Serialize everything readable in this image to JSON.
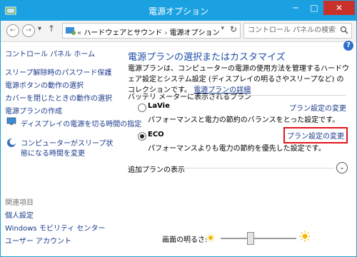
{
  "window": {
    "title": "電源オプション",
    "controls": {
      "minimize": "─",
      "maximize": "□",
      "close": "✕"
    }
  },
  "nav": {
    "back": "←",
    "forward": "→",
    "recent": "▾",
    "up": "↑",
    "breadcrumb": {
      "prefix": "«",
      "item1": "ハードウェアとサウンド",
      "separator": "›",
      "item2": "電源オプション"
    },
    "dropdown": "▾",
    "refresh": "↻",
    "search_placeholder": "コントロール パネルの検索"
  },
  "help": "?",
  "sidebar": {
    "home": "コントロール パネル ホーム",
    "items": [
      "スリープ解除時のパスワード保護",
      "電源ボタンの動作の選択",
      "カバーを閉じたときの動作の選択",
      "電源プランの作成",
      "ディスプレイの電源を切る時間の指定",
      "コンピューターがスリープ状態になる時間を変更"
    ],
    "related_heading": "関連項目",
    "related": [
      "個人設定",
      "Windows モビリティ センター",
      "ユーザー アカウント"
    ]
  },
  "main": {
    "title": "電源プランの選択またはカスタマイズ",
    "description": "電源プランは、コンピューターの電源の使用方法を管理するハードウェア設定とシステム設定 (ディスプレイの明るさやスリープなど) のコレクションです。",
    "description_link": "電源プランの詳細",
    "group_label": "バッテリ メーターに表示されるプラン",
    "plans": [
      {
        "name": "LaVie",
        "desc": "パフォーマンスと電力の節約のバランスをとった設定です。",
        "link": "プラン設定の変更",
        "selected": false
      },
      {
        "name": "ECO",
        "desc": "パフォーマンスよりも電力の節約を優先した設定です。",
        "link": "プラン設定の変更",
        "selected": true
      }
    ],
    "more_plans": "追加プランの表示",
    "expand": "⌄"
  },
  "brightness": {
    "label": "画面の明るさ:",
    "level": 0.4
  },
  "colors": {
    "titlebar": "#1ba1e2",
    "link": "#1a3a8a",
    "heading": "#1e4ea8",
    "highlight": "#e2141a"
  }
}
